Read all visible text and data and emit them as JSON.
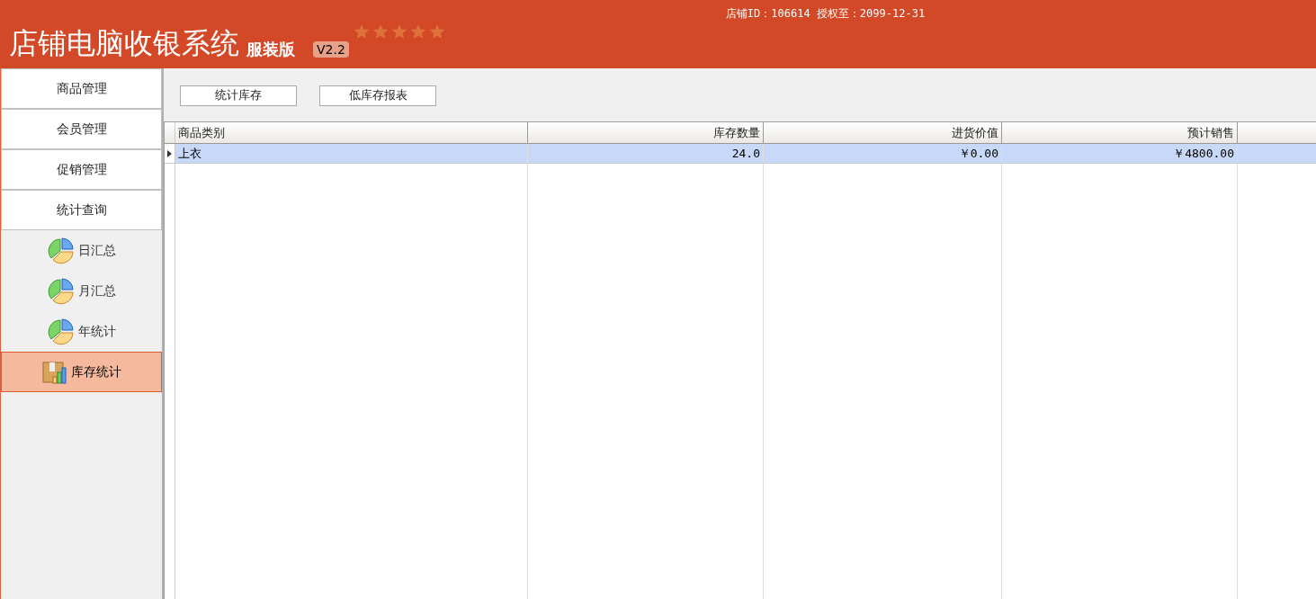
{
  "header": {
    "title": "店铺电脑收银系统",
    "edition": "服装版",
    "version": "V2.2",
    "stars": 5,
    "shop_info": "店铺ID：106614 授权至：2099-12-31"
  },
  "sidebar": {
    "menu": [
      {
        "label": "商品管理"
      },
      {
        "label": "会员管理"
      },
      {
        "label": "促销管理"
      },
      {
        "label": "统计查询"
      }
    ],
    "submenu": [
      {
        "label": "日汇总",
        "kind": "pie",
        "selected": false
      },
      {
        "label": "月汇总",
        "kind": "pie",
        "selected": false
      },
      {
        "label": "年统计",
        "kind": "pie",
        "selected": false
      },
      {
        "label": "库存统计",
        "kind": "stock",
        "selected": true
      }
    ]
  },
  "toolbar": {
    "buttons": [
      "统计库存",
      "低库存报表"
    ]
  },
  "table": {
    "columns": [
      {
        "label": "商品类别"
      },
      {
        "label": "库存数量"
      },
      {
        "label": "进货价值"
      },
      {
        "label": "预计销售"
      }
    ],
    "rows": [
      {
        "cells": [
          "上衣",
          "24.0",
          "￥0.00",
          "￥4800.00"
        ],
        "selected": true
      }
    ]
  }
}
